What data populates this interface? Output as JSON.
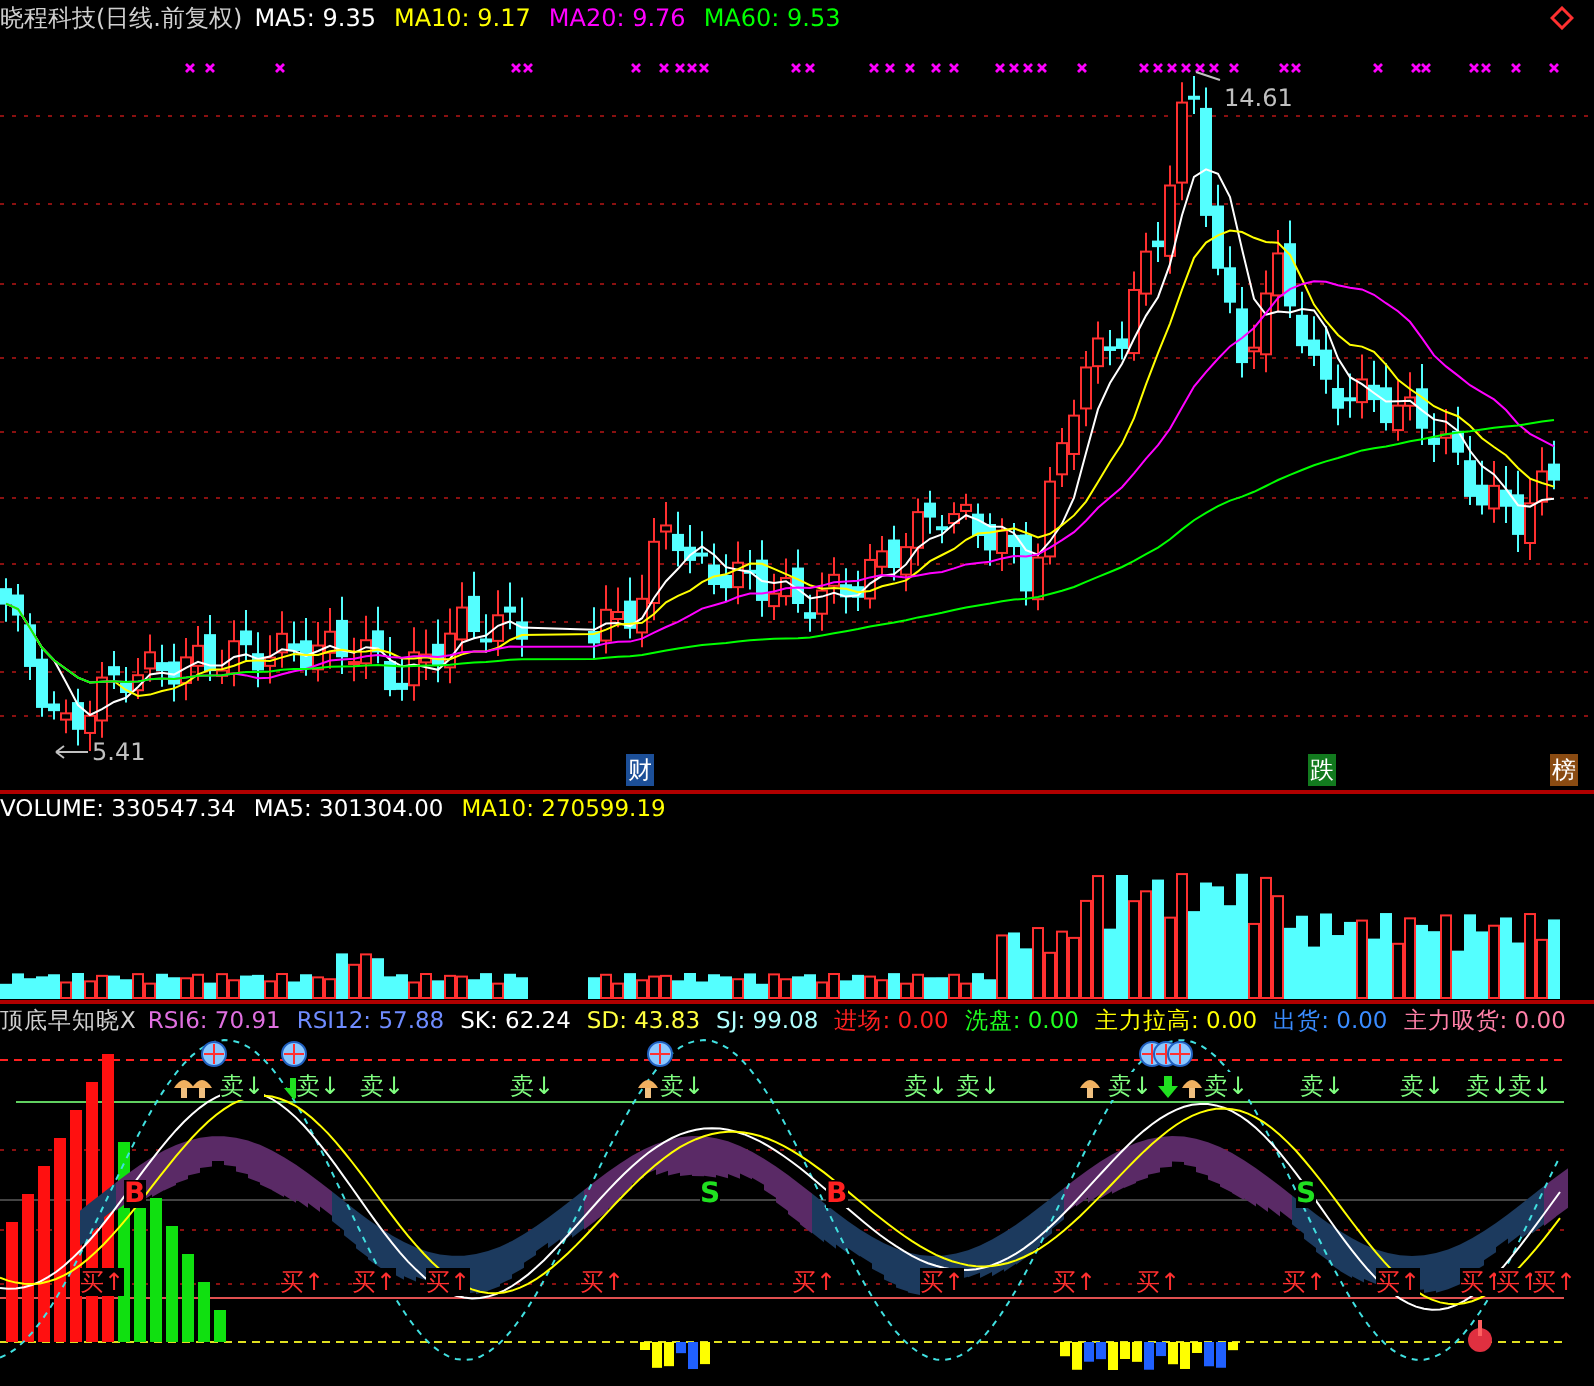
{
  "main": {
    "title": "晓程科技(日线.前复权)",
    "ma": [
      {
        "label": "MA5: 9.35",
        "color": "#ffffff"
      },
      {
        "label": "MA10: 9.17",
        "color": "#ffff00"
      },
      {
        "label": "MA20: 9.76",
        "color": "#ff00ff"
      },
      {
        "label": "MA60: 9.53",
        "color": "#00ff00"
      }
    ],
    "price_labels": [
      {
        "text": "14.61"
      },
      {
        "text": "5.41"
      }
    ],
    "event_tags": [
      {
        "text": "财",
        "color": "#1c4f98"
      },
      {
        "text": "跌",
        "color": "#127a1e"
      },
      {
        "text": "榜",
        "color": "#8a4b12"
      }
    ]
  },
  "volume": {
    "items": [
      {
        "label": "VOLUME: 330547.34",
        "color": "#ffffff"
      },
      {
        "label": "MA5: 301304.00",
        "color": "#ffffff"
      },
      {
        "label": "MA10: 270599.19",
        "color": "#ffff00"
      }
    ]
  },
  "indicator": {
    "title": "顶底早知晓X",
    "items": [
      {
        "label": "RSI6: 70.91",
        "color": "#e070e0"
      },
      {
        "label": "RSI12: 57.88",
        "color": "#6f8cff"
      },
      {
        "label": "SK: 62.24",
        "color": "#ffffff"
      },
      {
        "label": "SD: 43.83",
        "color": "#ffff40"
      },
      {
        "label": "SJ: 99.08",
        "color": "#b0ffff"
      },
      {
        "label": "进场: 0.00",
        "color": "#ff2020"
      },
      {
        "label": "洗盘: 0.00",
        "color": "#20ff20"
      },
      {
        "label": "主力拉高: 0.00",
        "color": "#ffff00"
      },
      {
        "label": "出货: 0.00",
        "color": "#3a8cff"
      },
      {
        "label": "主力吸货: 0.00",
        "color": "#ff80a8"
      }
    ],
    "signals": [
      {
        "kind": "sell",
        "text": "卖↓"
      },
      {
        "kind": "sell",
        "text": "卖↓"
      },
      {
        "kind": "sell",
        "text": "卖↓"
      },
      {
        "kind": "sell",
        "text": "卖↓"
      },
      {
        "kind": "sell",
        "text": "卖↓"
      },
      {
        "kind": "sell",
        "text": "卖↓"
      },
      {
        "kind": "sell",
        "text": "卖↓"
      },
      {
        "kind": "sell",
        "text": "卖↓"
      },
      {
        "kind": "sell",
        "text": "卖↓"
      },
      {
        "kind": "sell",
        "text": "卖↓"
      },
      {
        "kind": "sell",
        "text": "卖↓"
      },
      {
        "kind": "sell",
        "text": "卖↓"
      },
      {
        "kind": "sell",
        "text": "卖↓"
      },
      {
        "kind": "buy",
        "text": "买↑"
      },
      {
        "kind": "buy",
        "text": "买↑"
      },
      {
        "kind": "buy",
        "text": "买↑"
      },
      {
        "kind": "buy",
        "text": "买↑"
      },
      {
        "kind": "buy",
        "text": "买↑"
      },
      {
        "kind": "buy",
        "text": "买↑"
      },
      {
        "kind": "buy",
        "text": "买↑"
      },
      {
        "kind": "buy",
        "text": "买↑"
      },
      {
        "kind": "buy",
        "text": "买↑"
      },
      {
        "kind": "buy",
        "text": "买↑"
      },
      {
        "kind": "buy",
        "text": "买↑"
      },
      {
        "kind": "buy",
        "text": "买↑"
      },
      {
        "kind": "buy",
        "text": "买↑"
      },
      {
        "kind": "buy",
        "text": "买↑"
      },
      {
        "kind": "point_b",
        "text": "B"
      },
      {
        "kind": "point_s",
        "text": "S"
      },
      {
        "kind": "point_b",
        "text": "B"
      },
      {
        "kind": "point_s",
        "text": "S"
      }
    ]
  }
}
